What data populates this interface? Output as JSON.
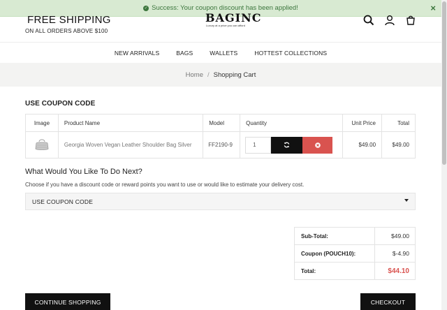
{
  "alert": {
    "message": "Success: Your coupon discount has been applied!",
    "close": "×"
  },
  "header": {
    "shipping_title": "FREE SHIPPING",
    "shipping_sub": "ON ALL ORDERS ABOVE $100",
    "logo": "BAGINC",
    "tagline": "Luxury at a price you can afford"
  },
  "nav": [
    "NEW ARRIVALS",
    "BAGS",
    "WALLETS",
    "HOTTEST COLLECTIONS"
  ],
  "breadcrumb": {
    "home": "Home",
    "separator": "/",
    "current": "Shopping Cart"
  },
  "coupon_title": "USE COUPON CODE",
  "cart": {
    "headers": [
      "Image",
      "Product Name",
      "Model",
      "Quantity",
      "Unit Price",
      "Total"
    ],
    "rows": [
      {
        "name": "Georgia Woven Vegan Leather Shoulder Bag Silver",
        "model": "FF2190-9",
        "quantity": "1",
        "unit_price": "$49.00",
        "total": "$49.00"
      }
    ]
  },
  "next": {
    "title": "What Would You Like To Do Next?",
    "desc": "Choose if you have a discount code or reward points you want to use or would like to estimate your delivery cost.",
    "accordion": "USE COUPON CODE"
  },
  "totals": [
    {
      "label": "Sub-Total:",
      "value": "$49.00"
    },
    {
      "label": "Coupon (POUCH10):",
      "value": "$-4.90"
    },
    {
      "label": "Total:",
      "value": "$44.10"
    }
  ],
  "buttons": {
    "continue": "CONTINUE SHOPPING",
    "checkout": "CHECKOUT"
  },
  "colors": {
    "accent_red": "#d9534f",
    "success_bg": "#d8ead2",
    "success_text": "#3c763d",
    "dark": "#111111"
  }
}
